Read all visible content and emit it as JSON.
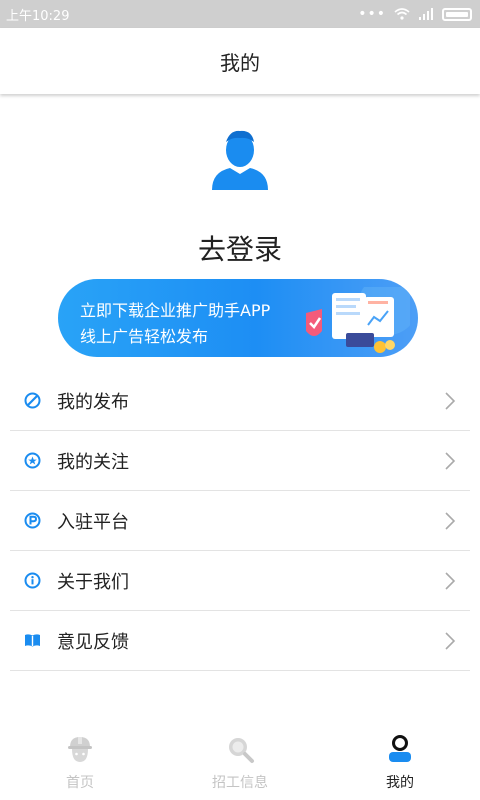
{
  "status_bar": {
    "time": "上午10:29",
    "dots": "•••"
  },
  "header": {
    "title": "我的"
  },
  "profile": {
    "login_label": "去登录"
  },
  "banner": {
    "line1": "立即下载企业推广助手APP",
    "line2": "线上广告轻松发布"
  },
  "menu": {
    "items": [
      {
        "label": "我的发布",
        "icon": "ban-circle-icon"
      },
      {
        "label": "我的关注",
        "icon": "star-circle-icon"
      },
      {
        "label": "入驻平台",
        "icon": "p-circle-icon"
      },
      {
        "label": "关于我们",
        "icon": "info-circle-icon"
      },
      {
        "label": "意见反馈",
        "icon": "book-icon"
      }
    ]
  },
  "bottom_nav": {
    "items": [
      {
        "label": "首页",
        "icon": "worker-helmet-icon",
        "active": false
      },
      {
        "label": "招工信息",
        "icon": "search-icon",
        "active": false
      },
      {
        "label": "我的",
        "icon": "profile-icon",
        "active": true
      }
    ]
  },
  "colors": {
    "accent": "#1a8cf0",
    "inactive": "#c4c4c4"
  }
}
